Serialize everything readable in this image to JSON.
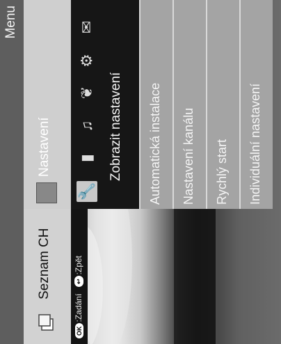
{
  "window": {
    "title": "Menu"
  },
  "left_panel": {
    "title": "Seznam CH",
    "hints": [
      {
        "button": "OK",
        "label": ":Zadání"
      },
      {
        "button": "↩",
        "label": ":Zpět"
      }
    ]
  },
  "right_panel": {
    "title": "Nastavení",
    "icons": [
      "wrench-icon",
      "picture-icon",
      "sound-icon",
      "eco-leaf-icon",
      "gear-icon",
      "mail-icon"
    ],
    "icon_caption": "Zobrazit nastavení",
    "items": [
      {
        "label": "Automatická instalace"
      },
      {
        "label": "Nastavení kanálu"
      },
      {
        "label": "Rychlý start"
      },
      {
        "label": "Individuální nastavení"
      }
    ]
  }
}
